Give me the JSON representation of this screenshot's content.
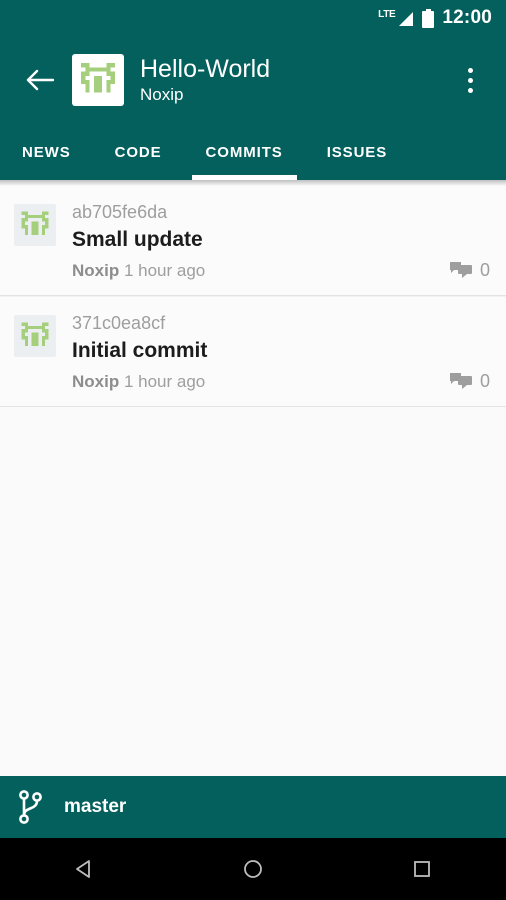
{
  "status_bar": {
    "network_label": "LTE",
    "signal_icon": "signal-bars-icon",
    "battery_icon": "battery-full-icon",
    "time": "12:00"
  },
  "toolbar": {
    "back_icon": "arrow-back-icon",
    "avatar_icon": "repo-identicon-avatar",
    "title": "Hello-World",
    "subtitle": "Noxip",
    "overflow_icon": "overflow-menu-icon"
  },
  "tabs": {
    "active_index": 2,
    "items": [
      {
        "label": "NEWS"
      },
      {
        "label": "CODE"
      },
      {
        "label": "COMMITS"
      },
      {
        "label": "ISSUES"
      }
    ]
  },
  "commits": [
    {
      "avatar_icon": "commit-author-identicon",
      "sha": "ab705fe6da",
      "message": "Small update",
      "author": "Noxip",
      "time": "1 hour ago",
      "comment_icon": "comment-bubbles-icon",
      "comment_count": "0"
    },
    {
      "avatar_icon": "commit-author-identicon",
      "sha": "371c0ea8cf",
      "message": "Initial commit",
      "author": "Noxip",
      "time": "1 hour ago",
      "comment_icon": "comment-bubbles-icon",
      "comment_count": "0"
    }
  ],
  "branch_bar": {
    "icon": "git-branch-icon",
    "name": "master"
  },
  "nav_bar": {
    "back_icon": "nav-back-icon",
    "home_icon": "nav-home-icon",
    "recents_icon": "nav-recents-icon"
  },
  "colors": {
    "primary": "#04605d",
    "accent_green": "#a5cf7d",
    "content_bg": "#fafafa",
    "muted_text": "#9e9e9e"
  }
}
